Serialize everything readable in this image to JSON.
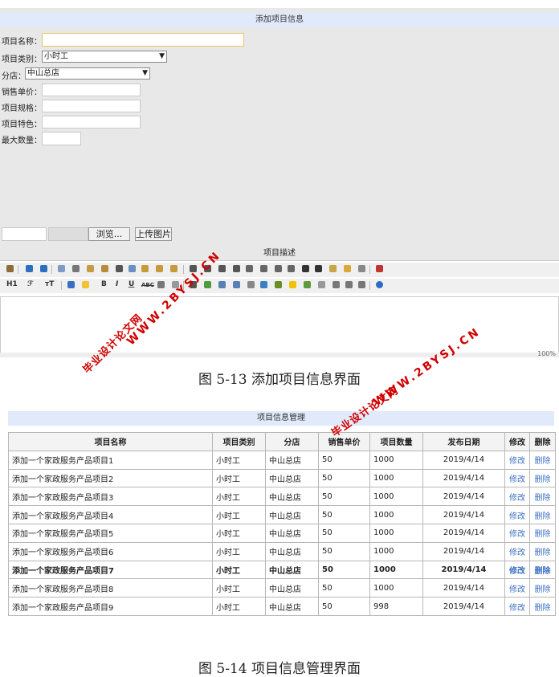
{
  "add_form": {
    "title": "添加项目信息",
    "fields": {
      "name_label": "项目名称：",
      "category_label": "项目类别：",
      "category_value": "小时工",
      "branch_label": "分店：",
      "branch_value": "中山总店",
      "price_label": "销售单价：",
      "spec_label": "项目规格：",
      "feature_label": "项目特色：",
      "max_label": "最大数量："
    },
    "upload": {
      "browse_label": "浏览...",
      "upload_label": "上传图片"
    },
    "desc_title": "项目描述",
    "toolbar": {
      "h1": "H1",
      "font": "ℱ",
      "size": "ᴛT",
      "bold": "B",
      "italic": "I",
      "underline": "U",
      "strike": "ABC"
    },
    "zoom": "100%"
  },
  "captions": {
    "fig13": "图 5-13 添加项目信息界面",
    "fig14": "图 5-14 项目信息管理界面"
  },
  "watermarks": {
    "cn": "毕业设计论文网",
    "url": "WWW.2BYSJ.CN"
  },
  "manage": {
    "title": "项目信息管理",
    "columns": [
      "项目名称",
      "项目类别",
      "分店",
      "销售单价",
      "项目数量",
      "发布日期",
      "修改",
      "删除"
    ],
    "rows": [
      {
        "name": "添加一个家政服务产品项目1",
        "cat": "小时工",
        "branch": "中山总店",
        "price": "50",
        "qty": "1000",
        "date": "2019/4/14",
        "edit": "修改",
        "del": "删除"
      },
      {
        "name": "添加一个家政服务产品项目2",
        "cat": "小时工",
        "branch": "中山总店",
        "price": "50",
        "qty": "1000",
        "date": "2019/4/14",
        "edit": "修改",
        "del": "删除"
      },
      {
        "name": "添加一个家政服务产品项目3",
        "cat": "小时工",
        "branch": "中山总店",
        "price": "50",
        "qty": "1000",
        "date": "2019/4/14",
        "edit": "修改",
        "del": "删除"
      },
      {
        "name": "添加一个家政服务产品项目4",
        "cat": "小时工",
        "branch": "中山总店",
        "price": "50",
        "qty": "1000",
        "date": "2019/4/14",
        "edit": "修改",
        "del": "删除"
      },
      {
        "name": "添加一个家政服务产品项目5",
        "cat": "小时工",
        "branch": "中山总店",
        "price": "50",
        "qty": "1000",
        "date": "2019/4/14",
        "edit": "修改",
        "del": "删除"
      },
      {
        "name": "添加一个家政服务产品项目6",
        "cat": "小时工",
        "branch": "中山总店",
        "price": "50",
        "qty": "1000",
        "date": "2019/4/14",
        "edit": "修改",
        "del": "删除"
      },
      {
        "name": "添加一个家政服务产品项目7",
        "cat": "小时工",
        "branch": "中山总店",
        "price": "50",
        "qty": "1000",
        "date": "2019/4/14",
        "edit": "修改",
        "del": "删除"
      },
      {
        "name": "添加一个家政服务产品项目8",
        "cat": "小时工",
        "branch": "中山总店",
        "price": "50",
        "qty": "1000",
        "date": "2019/4/14",
        "edit": "修改",
        "del": "删除"
      },
      {
        "name": "添加一个家政服务产品项目9",
        "cat": "小时工",
        "branch": "中山总店",
        "price": "50",
        "qty": "998",
        "date": "2019/4/14",
        "edit": "修改",
        "del": "删除"
      }
    ]
  }
}
